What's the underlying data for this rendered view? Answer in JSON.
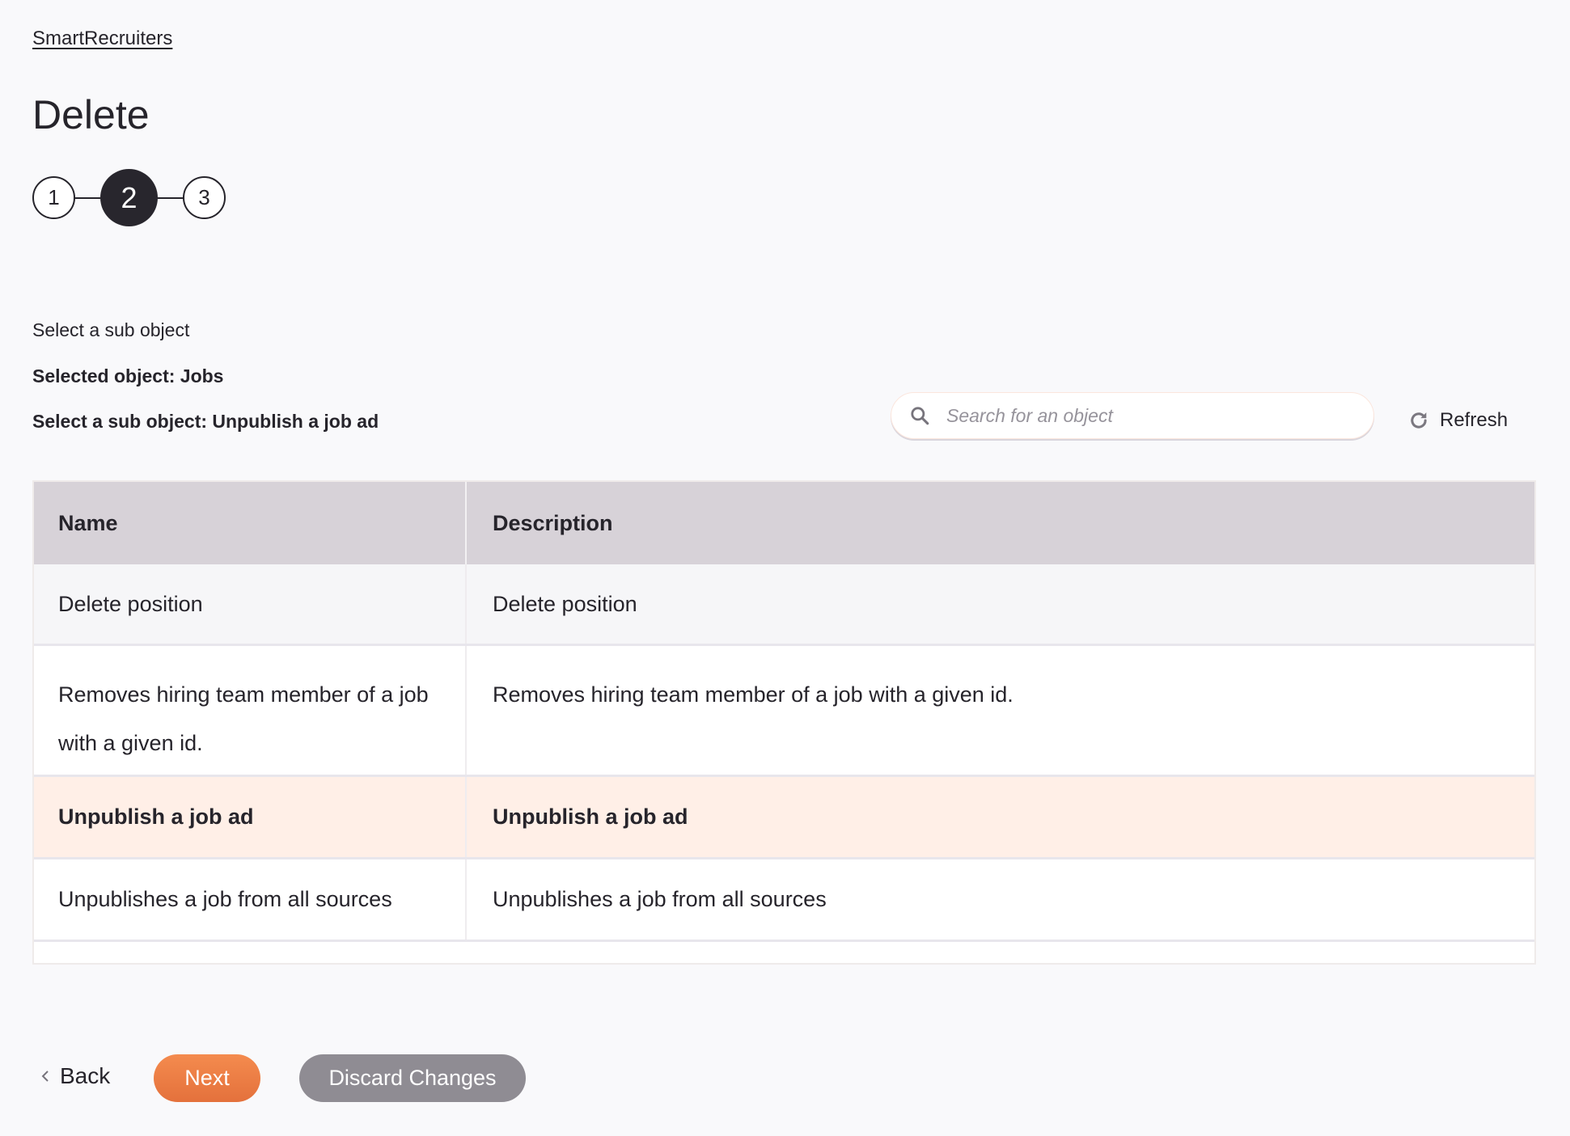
{
  "breadcrumb": {
    "label": "SmartRecruiters"
  },
  "page": {
    "title": "Delete"
  },
  "stepper": {
    "steps": [
      "1",
      "2",
      "3"
    ],
    "active_step": 2
  },
  "section": {
    "heading": "Select a sub object",
    "selected_object": "Selected object: Jobs",
    "selected_sub_object": "Select a sub object: Unpublish a job ad"
  },
  "search": {
    "placeholder": "Search for an object",
    "value": "",
    "icon": "search-icon"
  },
  "refresh": {
    "label": "Refresh",
    "icon": "refresh-icon"
  },
  "table": {
    "columns": [
      "Name",
      "Description"
    ],
    "rows": [
      {
        "name": "Delete position",
        "description": "Delete position",
        "selected": false
      },
      {
        "name": "Removes hiring team member of a job with a given id.",
        "description": "Removes hiring team member of a job with a given id.",
        "selected": false
      },
      {
        "name": "Unpublish a job ad",
        "description": "Unpublish a job ad",
        "selected": true
      },
      {
        "name": "Unpublishes a job from all sources",
        "description": "Unpublishes a job from all sources",
        "selected": false
      }
    ]
  },
  "footer": {
    "back_label": "Back",
    "next_label": "Next",
    "discard_label": "Discard Changes"
  },
  "colors": {
    "accent": "#ef7e45",
    "selected_row": "#ffefe7",
    "header_bg": "#d7d2d8",
    "discard_bg": "#8f8c93"
  }
}
